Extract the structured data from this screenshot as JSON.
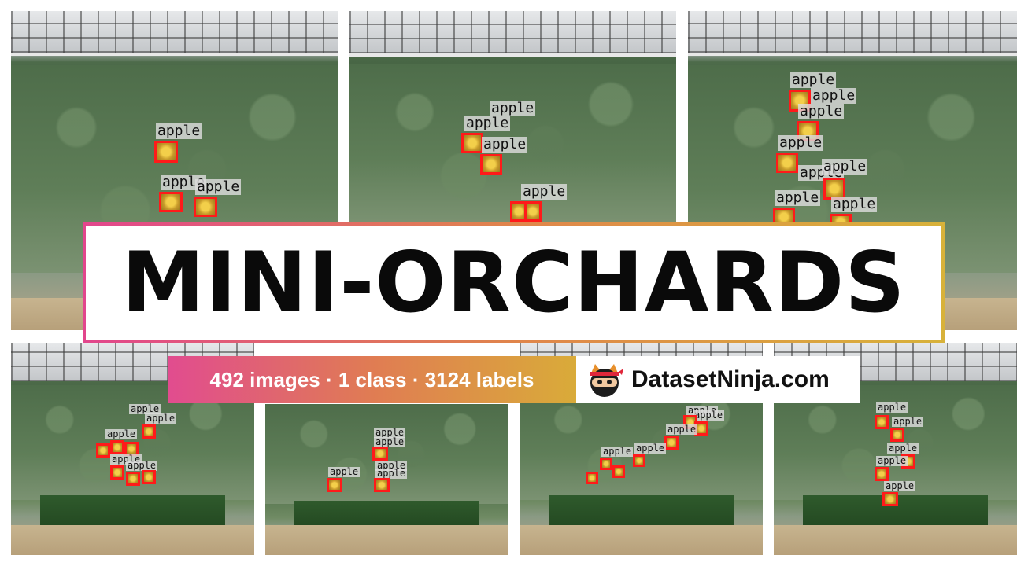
{
  "title": "MINI-ORCHARDS",
  "stats": "492 images · 1 class · 3124 labels",
  "brand": {
    "name": "DatasetNinja.com",
    "logo": "ninja-cat-icon"
  },
  "label_text": "apple",
  "colors": {
    "box": "#ff1a1a",
    "gradient_start": "#e14c8f",
    "gradient_mid": "#e07c53",
    "gradient_end": "#d9ab39"
  }
}
